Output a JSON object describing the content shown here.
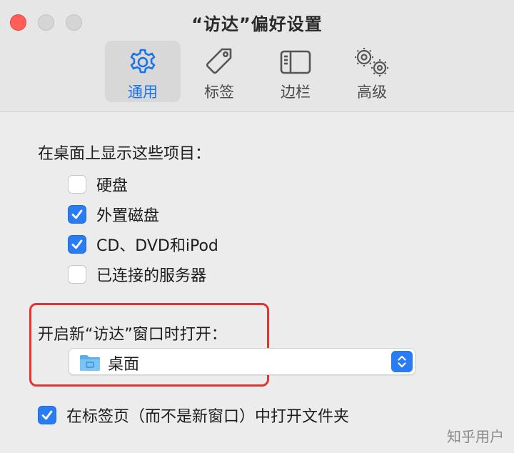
{
  "window": {
    "title": "“访达”偏好设置"
  },
  "tabs": [
    {
      "label": "通用",
      "icon": "gear-icon",
      "active": true
    },
    {
      "label": "标签",
      "icon": "tag-icon",
      "active": false
    },
    {
      "label": "边栏",
      "icon": "sidebar-icon",
      "active": false
    },
    {
      "label": "高级",
      "icon": "gears-icon",
      "active": false
    }
  ],
  "desktop_items": {
    "heading": "在桌面上显示这些项目：",
    "items": [
      {
        "label": "硬盘",
        "checked": false
      },
      {
        "label": "外置磁盘",
        "checked": true
      },
      {
        "label": "CD、DVD和iPod",
        "checked": true
      },
      {
        "label": "已连接的服务器",
        "checked": false
      }
    ]
  },
  "new_window": {
    "heading": "开启新“访达”窗口时打开：",
    "selected": "桌面"
  },
  "open_in_tabs": {
    "label": "在标签页（而不是新窗口）中打开文件夹",
    "checked": true
  },
  "watermark": "知乎用户",
  "colors": {
    "accent": "#2a7cf5",
    "highlight": "#e8322c",
    "close": "#ff5f57"
  }
}
